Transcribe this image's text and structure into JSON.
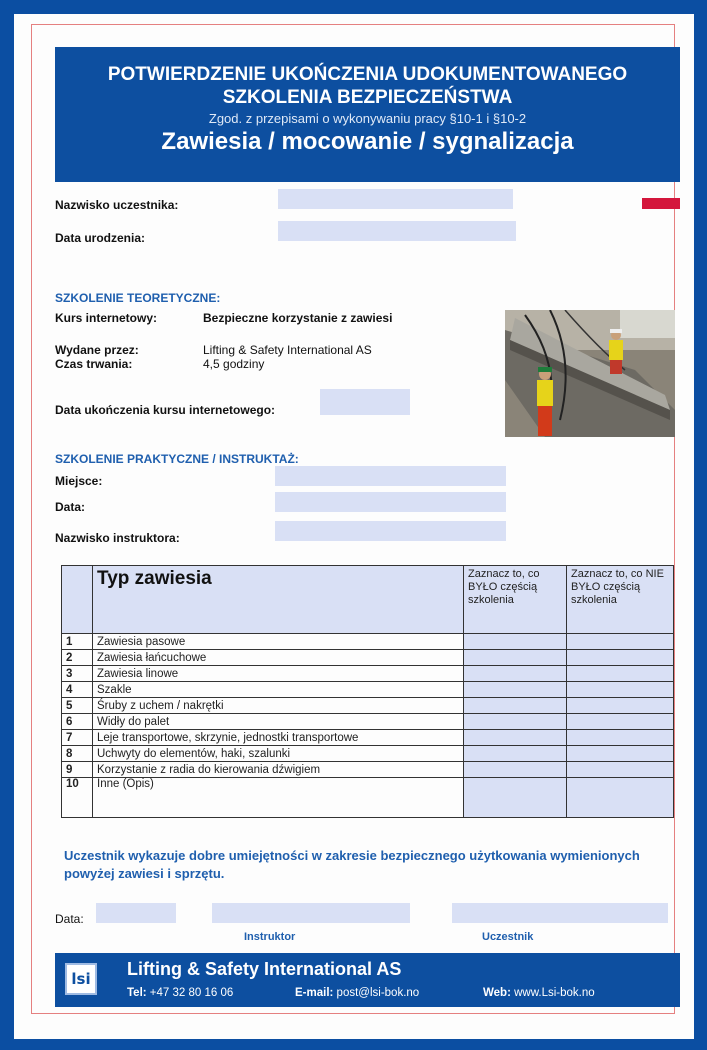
{
  "header": {
    "title": "POTWIERDZENIE UKOŃCZENIA UDOKUMENTOWANEGO SZKOLENIA BEZPIECZEŃSTWA",
    "regulation": "Zgod. z przepisami o wykonywaniu pracy §10-1 i §10-2",
    "topic": "Zawiesia / mocowanie / sygnalizacja"
  },
  "participant": {
    "name_label": "Nazwisko uczestnika:",
    "dob_label": "Data urodzenia:"
  },
  "theory": {
    "heading": "SZKOLENIE TEORETYCZNE:",
    "course_label": "Kurs internetowy:",
    "course_value": "Bezpieczne korzystanie z zawiesi",
    "issuer_label": "Wydane przez:",
    "issuer_value": "Lifting & Safety International AS",
    "duration_label": "Czas trwania:",
    "duration_value": "4,5 godziny",
    "completion_label": "Data ukończenia kursu internetowego:"
  },
  "practice": {
    "heading": "SZKOLENIE PRAKTYCZNE / INSTRUKTAŻ:",
    "place_label": "Miejsce:",
    "date_label": "Data:",
    "instructor_label": "Nazwisko instruktora:"
  },
  "table": {
    "col_type": "Typ zawiesia",
    "col_done": "Zaznacz to, co BYŁO częścią szkolenia",
    "col_not_done": "Zaznacz to, co NIE BYŁO częścią szkolenia",
    "rows": [
      {
        "num": "1",
        "type": "Zawiesia pasowe"
      },
      {
        "num": "2",
        "type": "Zawiesia łańcuchowe"
      },
      {
        "num": "3",
        "type": "Zawiesia linowe"
      },
      {
        "num": "4",
        "type": "Szakle"
      },
      {
        "num": "5",
        "type": "Śruby z uchem / nakrętki"
      },
      {
        "num": "6",
        "type": "Widły do palet"
      },
      {
        "num": "7",
        "type": "Leje transportowe, skrzynie, jednostki transportowe"
      },
      {
        "num": "8",
        "type": "Uchwyty do elementów, haki, szalunki"
      },
      {
        "num": "9",
        "type": "Korzystanie z radia do kierowania dźwigiem"
      },
      {
        "num": "10",
        "type": "Inne (Opis)"
      }
    ]
  },
  "statement": "Uczestnik wykazuje dobre umiejętności w zakresie bezpiecznego użytkowania wymienionych powyżej zawiesi i sprzętu.",
  "signatures": {
    "date_label": "Data:",
    "instructor": "Instruktor",
    "participant": "Uczestnik"
  },
  "footer": {
    "logo": "lsi",
    "company": "Lifting & Safety International AS",
    "tel_label": "Tel:",
    "tel": "+47 32 80 16 06",
    "email_label": "E-mail:",
    "email": "post@lsi-bok.no",
    "web_label": "Web:",
    "web": "www.Lsi-bok.no"
  },
  "colors": {
    "brand_blue": "#0d4fa0",
    "field_fill": "#d9e0f5",
    "accent_red": "#d4163c"
  }
}
